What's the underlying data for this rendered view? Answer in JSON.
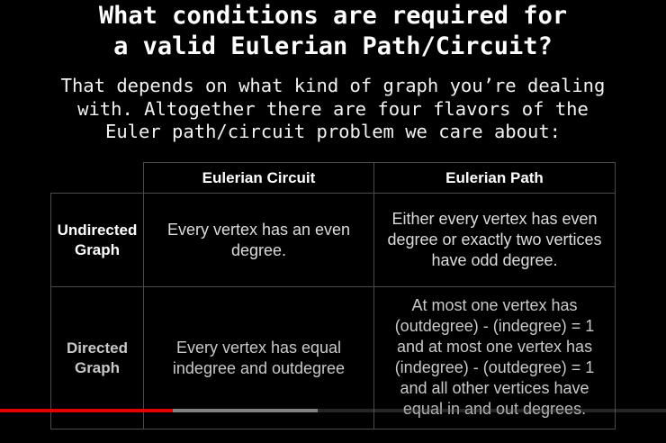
{
  "slide": {
    "title_lines": [
      "What conditions are required for",
      "a valid Eulerian Path/Circuit?"
    ],
    "intro_lines": [
      "That depends on what kind of graph you’re dealing",
      "with. Altogether there are four flavors of the",
      "Euler path/circuit problem we care about:"
    ]
  },
  "table": {
    "col_headers": [
      "Eulerian Circuit",
      "Eulerian Path"
    ],
    "rows": [
      {
        "header_lines": [
          "Undirected",
          "Graph"
        ],
        "circuit_lines": [
          "Every vertex has an even",
          "degree."
        ],
        "path_lines": [
          "Either every vertex has even",
          "degree or exactly two vertices",
          "have odd degree."
        ]
      },
      {
        "header_lines": [
          "Directed",
          "Graph"
        ],
        "circuit_lines": [
          "Every vertex has equal",
          "indegree and outdegree"
        ],
        "path_lines": [
          "At most one vertex has",
          "(outdegree) - (indegree) = 1",
          "and at most one vertex has",
          "(indegree) - (outdegree) = 1",
          "and all other vertices have",
          "equal in and out degrees."
        ]
      }
    ]
  },
  "player": {
    "progress_fraction": 0.26,
    "buffered_fraction": 0.477,
    "progress_color": "#e00000"
  }
}
